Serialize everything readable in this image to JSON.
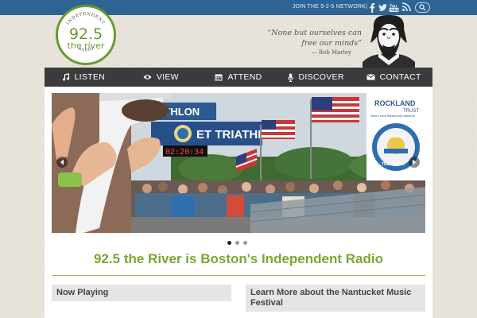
{
  "topbar": {
    "network_label": "JOIN THE 9-2-5 NETWORK|",
    "social_icons": [
      "facebook-icon",
      "twitter-icon",
      "youtube-icon",
      "rss-icon"
    ],
    "search_icon": "search-icon"
  },
  "logo": {
    "top_text": "INDEPENDENT",
    "number": "92.5",
    "name": "the river",
    "bottom_text": "RADIO"
  },
  "quote": {
    "text": "“None but ourselves can free our minds”",
    "author": "— Bob Marley"
  },
  "nav": {
    "items": [
      {
        "label": "LISTEN",
        "icon": "music-icon"
      },
      {
        "label": "VIEW",
        "icon": "eye-icon"
      },
      {
        "label": "ATTEND",
        "icon": "calendar-icon"
      },
      {
        "label": "DISCOVER",
        "icon": "microphone-icon"
      },
      {
        "label": "CONTACT",
        "icon": "envelope-icon"
      }
    ]
  },
  "slider": {
    "banner_text_1": "RIATHLON",
    "banner_text_2": "ET TRIATHLON",
    "timer": "02:20:34",
    "sponsor_name": "ROCKLAND",
    "sponsor_sub": "TRUST",
    "sponsor_tagline": "Where Each Relationship Matters®",
    "badge_top": "COHASSET",
    "badge_bottom": "TRIATHLON",
    "slide_count": 3,
    "active_slide": 1
  },
  "main": {
    "headline": "92.5 the River is Boston's Independent Radio",
    "now_playing": "Now Playing",
    "learn_more": "Learn More about the Nantucket Music Festival"
  },
  "colors": {
    "topbar": "#2e6396",
    "nav": "#3b3b3b",
    "accent_green": "#7ca634"
  }
}
